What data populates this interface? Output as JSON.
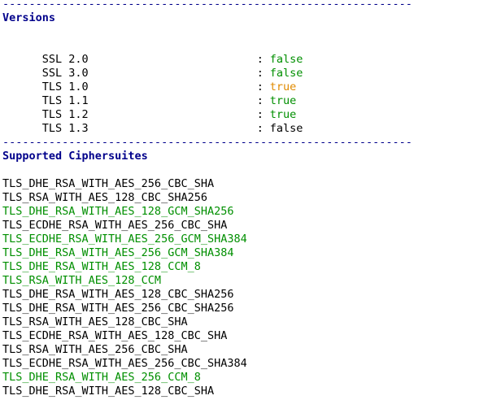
{
  "separator": "--------------------------------------------------------------",
  "versions": {
    "heading": "Versions",
    "items": [
      {
        "name": "SSL 2.0",
        "value": "false",
        "color": "#008f00"
      },
      {
        "name": "SSL 3.0",
        "value": "false",
        "color": "#008f00"
      },
      {
        "name": "TLS 1.0",
        "value": "true",
        "color": "#e08a00"
      },
      {
        "name": "TLS 1.1",
        "value": "true",
        "color": "#008f00"
      },
      {
        "name": "TLS 1.2",
        "value": "true",
        "color": "#008f00"
      },
      {
        "name": "TLS 1.3",
        "value": "false",
        "color": "#000000"
      }
    ]
  },
  "ciphersuites": {
    "heading": "Supported Ciphersuites",
    "items": [
      {
        "name": "TLS_DHE_RSA_WITH_AES_256_CBC_SHA",
        "color": "#000000"
      },
      {
        "name": "TLS_RSA_WITH_AES_128_CBC_SHA256",
        "color": "#000000"
      },
      {
        "name": "TLS_DHE_RSA_WITH_AES_128_GCM_SHA256",
        "color": "#008f00"
      },
      {
        "name": "TLS_ECDHE_RSA_WITH_AES_256_CBC_SHA",
        "color": "#000000"
      },
      {
        "name": "TLS_ECDHE_RSA_WITH_AES_256_GCM_SHA384",
        "color": "#008f00"
      },
      {
        "name": "TLS_DHE_RSA_WITH_AES_256_GCM_SHA384",
        "color": "#008f00"
      },
      {
        "name": "TLS_DHE_RSA_WITH_AES_128_CCM_8",
        "color": "#008f00"
      },
      {
        "name": "TLS_RSA_WITH_AES_128_CCM",
        "color": "#008f00"
      },
      {
        "name": "TLS_DHE_RSA_WITH_AES_128_CBC_SHA256",
        "color": "#000000"
      },
      {
        "name": "TLS_DHE_RSA_WITH_AES_256_CBC_SHA256",
        "color": "#000000"
      },
      {
        "name": "TLS_RSA_WITH_AES_128_CBC_SHA",
        "color": "#000000"
      },
      {
        "name": "TLS_ECDHE_RSA_WITH_AES_128_CBC_SHA",
        "color": "#000000"
      },
      {
        "name": "TLS_RSA_WITH_AES_256_CBC_SHA",
        "color": "#000000"
      },
      {
        "name": "TLS_ECDHE_RSA_WITH_AES_256_CBC_SHA384",
        "color": "#000000"
      },
      {
        "name": "TLS_DHE_RSA_WITH_AES_256_CCM_8",
        "color": "#008f00"
      },
      {
        "name": "TLS_DHE_RSA_WITH_AES_128_CBC_SHA",
        "color": "#000000"
      }
    ]
  }
}
